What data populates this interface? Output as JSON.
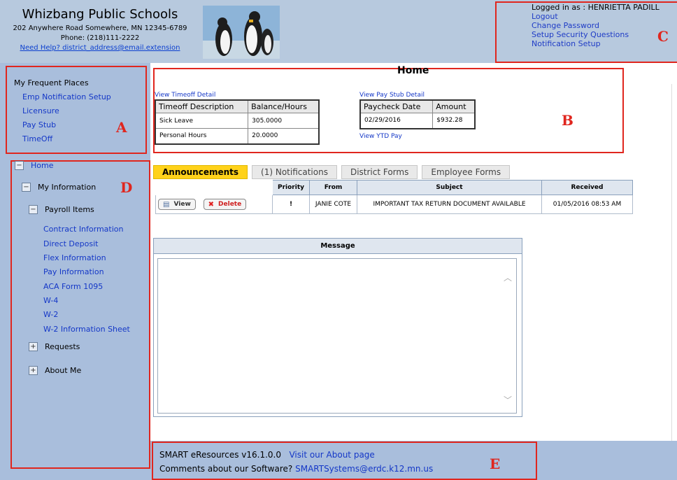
{
  "header": {
    "school_name": "Whizbang Public Schools",
    "address": "202 Anywhere Road Somewhere, MN 12345-6789",
    "phone": "Phone: (218)111-2222",
    "help_link": "Need Help? district_address@email.extension",
    "logged_in": "Logged in as : HENRIETTA PADILL",
    "links": [
      "Logout",
      "Change Password",
      "Setup Security Questions",
      "Notification Setup"
    ]
  },
  "callouts": {
    "a": "A",
    "b": "B",
    "c": "C",
    "d": "D",
    "e": "E"
  },
  "frequent": {
    "title": "My Frequent Places",
    "items": [
      "Emp Notification Setup",
      "Licensure",
      "Pay Stub",
      "TimeOff"
    ]
  },
  "tree": {
    "home": "Home",
    "my_information": "My Information",
    "payroll_items": "Payroll Items",
    "payroll_links": [
      "Contract Information",
      "Direct Deposit",
      "Flex Information",
      "Pay Information",
      "ACA Form 1095",
      "W-4",
      "W-2",
      "W-2 Information Sheet"
    ],
    "requests": "Requests",
    "about_me": "About Me"
  },
  "home": {
    "title": "Home",
    "timeoff_link": "View Timeoff Detail",
    "timeoff_headers": [
      "Timeoff Description",
      "Balance/Hours"
    ],
    "timeoff_rows": [
      [
        "Sick Leave",
        "305.0000"
      ],
      [
        "Personal Hours",
        "20.0000"
      ]
    ],
    "paystub_link": "View Pay Stub Detail",
    "paystub_headers": [
      "Paycheck Date",
      "Amount"
    ],
    "paystub_rows": [
      [
        "02/29/2016",
        "$932.28"
      ]
    ],
    "ytd_link": "View YTD Pay"
  },
  "tabs": [
    "Announcements",
    "(1) Notifications",
    "District Forms",
    "Employee Forms"
  ],
  "announcements": {
    "headers": [
      "Priority",
      "From",
      "Subject",
      "Received"
    ],
    "view_label": "View",
    "delete_label": "Delete",
    "rows": [
      {
        "priority": "!",
        "from": "JANIE COTE",
        "subject": "IMPORTANT TAX RETURN DOCUMENT AVAILABLE",
        "received": "01/05/2016 08:53 AM"
      }
    ]
  },
  "message": {
    "header": "Message",
    "value": ""
  },
  "footer": {
    "version": "SMART eResources v16.1.0.0",
    "about_link": "Visit our About page",
    "comments": "Comments about our Software?",
    "email_link": "SMARTSystems@erdc.k12.mn.us"
  },
  "colors": {
    "header_bg": "#b7c9de",
    "sidebar_bg": "#a9bedc",
    "callout_red": "#e0261e",
    "link_blue": "#1437c7",
    "active_tab": "#ffd21a"
  }
}
